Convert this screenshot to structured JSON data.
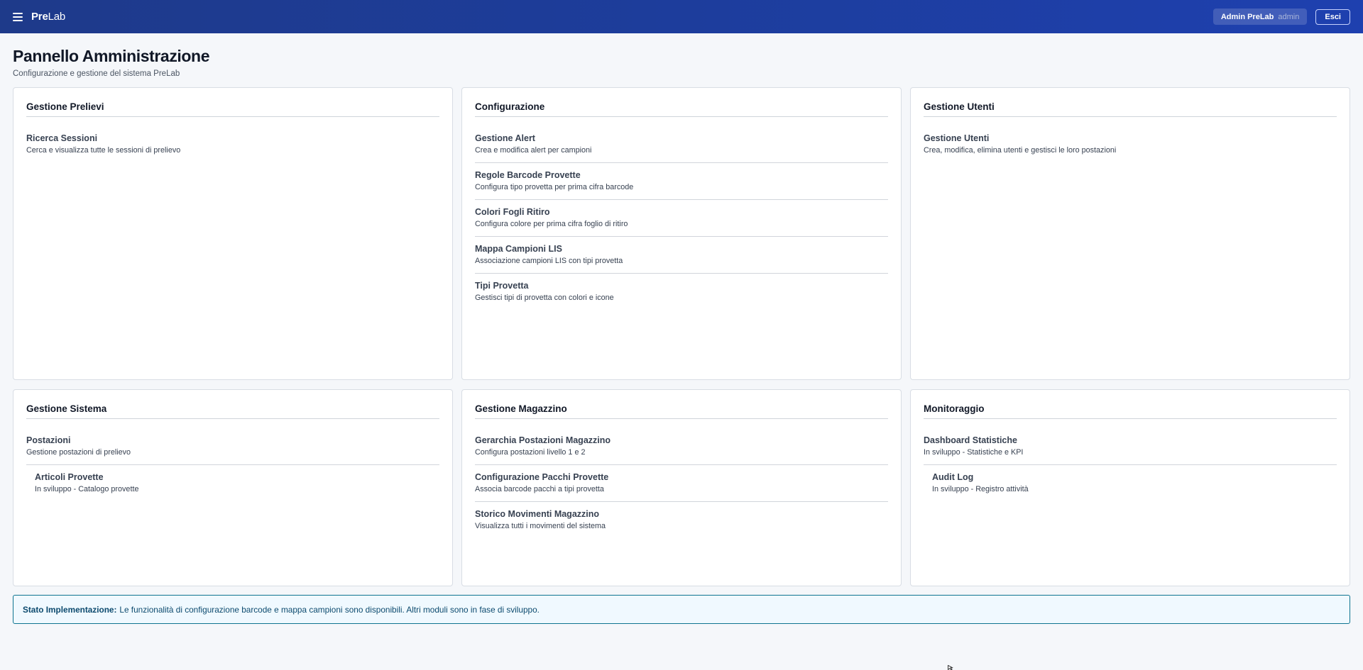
{
  "app": {
    "logo_part1": "Pre",
    "logo_part2": "Lab",
    "user_name": "Admin PreLab",
    "user_role": "admin",
    "logout_label": "Esci"
  },
  "page": {
    "title": "Pannello Amministrazione",
    "subtitle": "Configurazione e gestione del sistema PreLab"
  },
  "cards": {
    "prelievi": {
      "title": "Gestione Prelievi",
      "items": [
        {
          "title": "Ricerca Sessioni",
          "desc": "Cerca e visualizza tutte le sessioni di prelievo"
        }
      ]
    },
    "configurazione": {
      "title": "Configurazione",
      "items": [
        {
          "title": "Gestione Alert",
          "desc": "Crea e modifica alert per campioni"
        },
        {
          "title": "Regole Barcode Provette",
          "desc": "Configura tipo provetta per prima cifra barcode"
        },
        {
          "title": "Colori Fogli Ritiro",
          "desc": "Configura colore per prima cifra foglio di ritiro"
        },
        {
          "title": "Mappa Campioni LIS",
          "desc": "Associazione campioni LIS con tipi provetta"
        },
        {
          "title": "Tipi Provetta",
          "desc": "Gestisci tipi di provetta con colori e icone"
        }
      ]
    },
    "utenti": {
      "title": "Gestione Utenti",
      "items": [
        {
          "title": "Gestione Utenti",
          "desc": "Crea, modifica, elimina utenti e gestisci le loro postazioni"
        }
      ]
    },
    "sistema": {
      "title": "Gestione Sistema",
      "items": [
        {
          "title": "Postazioni",
          "desc": "Gestione postazioni di prelievo"
        },
        {
          "title": "Articoli Provette",
          "desc": "In sviluppo - Catalogo provette"
        }
      ]
    },
    "magazzino": {
      "title": "Gestione Magazzino",
      "items": [
        {
          "title": "Gerarchia Postazioni Magazzino",
          "desc": "Configura postazioni livello 1 e 2"
        },
        {
          "title": "Configurazione Pacchi Provette",
          "desc": "Associa barcode pacchi a tipi provetta"
        },
        {
          "title": "Storico Movimenti Magazzino",
          "desc": "Visualizza tutti i movimenti del sistema"
        }
      ]
    },
    "monitoraggio": {
      "title": "Monitoraggio",
      "items": [
        {
          "title": "Dashboard Statistiche",
          "desc": "In sviluppo - Statistiche e KPI"
        },
        {
          "title": "Audit Log",
          "desc": "In sviluppo - Registro attività"
        }
      ]
    }
  },
  "banner": {
    "label": "Stato Implementazione:",
    "text": "Le funzionalità di configurazione barcode e mappa campioni sono disponibili. Altri moduli sono in fase di sviluppo."
  },
  "icons": {
    "menu": "hamburger-menu-icon",
    "cursor": "mouse-cursor-icon"
  },
  "colors": {
    "header_bg": "#1e3a8a",
    "banner_border": "#0e7490",
    "banner_bg": "#f0f9ff"
  }
}
